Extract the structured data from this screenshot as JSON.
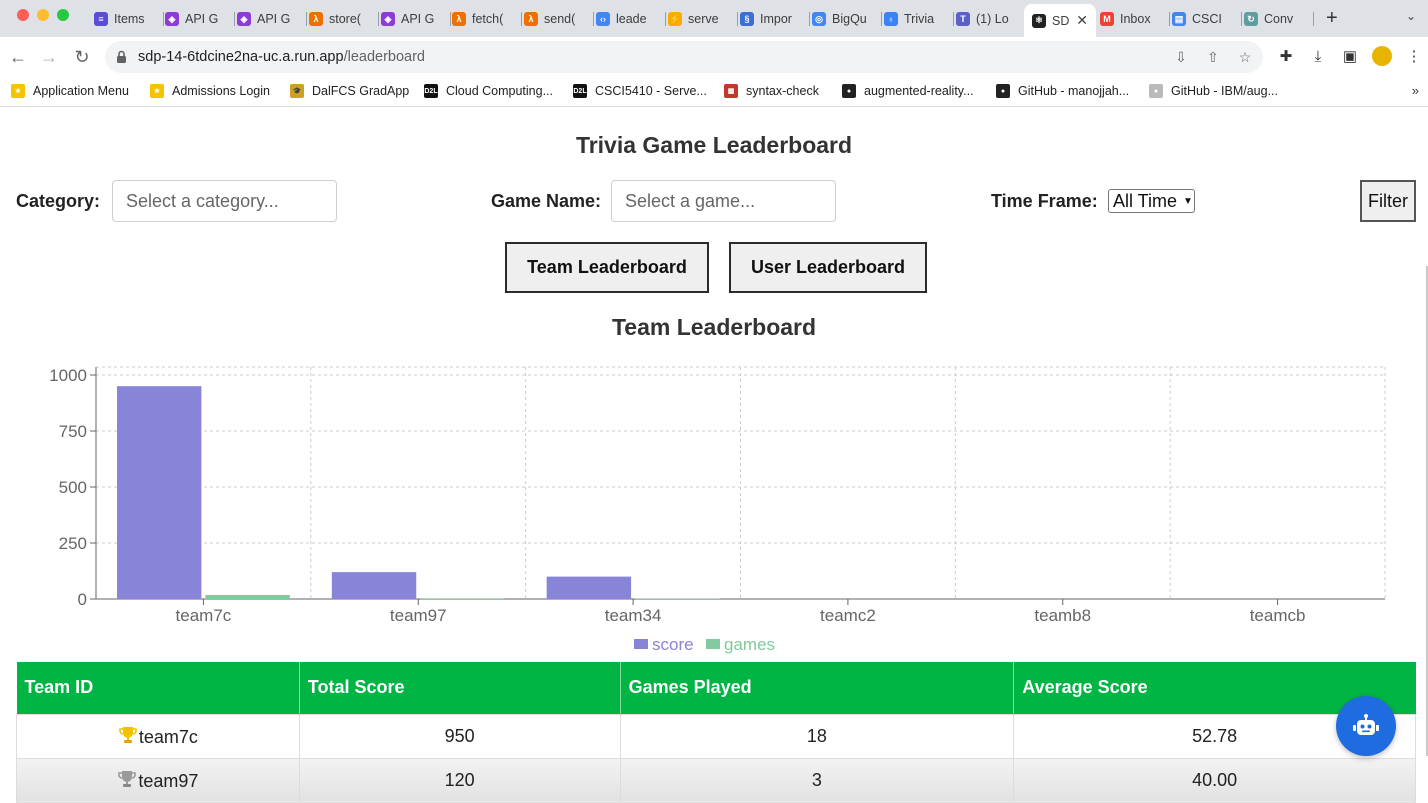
{
  "browser": {
    "tabs": [
      {
        "label": "Items",
        "color": "#5b4bdb",
        "glyph": "≡"
      },
      {
        "label": "API G",
        "color": "#8b3bd6",
        "glyph": "◈"
      },
      {
        "label": "API G",
        "color": "#8b3bd6",
        "glyph": "◈"
      },
      {
        "label": "store(",
        "color": "#ed7100",
        "glyph": "λ"
      },
      {
        "label": "API G",
        "color": "#8b3bd6",
        "glyph": "◈"
      },
      {
        "label": "fetch(",
        "color": "#ed7100",
        "glyph": "λ"
      },
      {
        "label": "send(",
        "color": "#ed7100",
        "glyph": "λ"
      },
      {
        "label": "leade",
        "color": "#4285f4",
        "glyph": "‹›"
      },
      {
        "label": "serve",
        "color": "#f9ab00",
        "glyph": "⚡"
      },
      {
        "label": "Impor",
        "color": "#3b6fd6",
        "glyph": "§"
      },
      {
        "label": "BigQu",
        "color": "#4285f4",
        "glyph": "◎"
      },
      {
        "label": "Trivia",
        "color": "#3b82f6",
        "glyph": "♁"
      },
      {
        "label": "(1) Lo",
        "color": "#5b5fc7",
        "glyph": "T"
      },
      {
        "label": "SD",
        "color": "#222222",
        "glyph": "⚛"
      },
      {
        "label": "Inbox",
        "color": "#ea4335",
        "glyph": "M"
      },
      {
        "label": "CSCI",
        "color": "#4285f4",
        "glyph": "▤"
      },
      {
        "label": "Conv",
        "color": "#5f9ea0",
        "glyph": "↻"
      }
    ],
    "url_host": "sdp-14-6tdcine2na-uc.a.run.app",
    "url_path": "/leaderboard",
    "bookmarks": [
      {
        "label": "Application Menu",
        "color": "#f5c400",
        "glyph": "★"
      },
      {
        "label": "Admissions Login",
        "color": "#f5c400",
        "glyph": "★"
      },
      {
        "label": "DalFCS GradApp",
        "color": "#c9a227",
        "glyph": "🎓"
      },
      {
        "label": "Cloud Computing...",
        "color": "#111111",
        "glyph": "D2L"
      },
      {
        "label": "CSCI5410 - Serve...",
        "color": "#111111",
        "glyph": "D2L"
      },
      {
        "label": "syntax-check",
        "color": "#c0392b",
        "glyph": "▦"
      },
      {
        "label": "augmented-reality...",
        "color": "#222222",
        "glyph": "●"
      },
      {
        "label": "GitHub - manojjah...",
        "color": "#222222",
        "glyph": "●"
      },
      {
        "label": "GitHub - IBM/aug...",
        "color": "#bbbbbb",
        "glyph": "●"
      }
    ]
  },
  "page": {
    "title": "Trivia Game Leaderboard",
    "filters": {
      "category_label": "Category:",
      "category_placeholder": "Select a category...",
      "game_label": "Game Name:",
      "game_placeholder": "Select a game...",
      "timeframe_label": "Time Frame:",
      "timeframe_value": "All Time",
      "filter_button": "Filter"
    },
    "toggle": {
      "team_button": "Team Leaderboard",
      "user_button": "User Leaderboard"
    },
    "section_title": "Team Leaderboard",
    "table": {
      "headers": [
        "Team ID",
        "Total Score",
        "Games Played",
        "Average Score"
      ],
      "rows": [
        {
          "rank_icon": "gold-trophy",
          "team": "team7c",
          "score": "950",
          "games": "18",
          "avg": "52.78"
        },
        {
          "rank_icon": "silver-trophy",
          "team": "team97",
          "score": "120",
          "games": "3",
          "avg": "40.00"
        }
      ]
    }
  },
  "chart_data": {
    "type": "bar",
    "categories": [
      "team7c",
      "team97",
      "team34",
      "teamc2",
      "teamb8",
      "teamcb"
    ],
    "series": [
      {
        "name": "score",
        "color": "#8884d8",
        "values": [
          950,
          120,
          100,
          0,
          0,
          0
        ]
      },
      {
        "name": "games",
        "color": "#82ca9d",
        "values": [
          18,
          3,
          2,
          0,
          0,
          0
        ]
      }
    ],
    "yticks": [
      "0",
      "250",
      "500",
      "750",
      "1000"
    ],
    "ylim": [
      0,
      1000
    ],
    "grid": true,
    "legend": "bottom-center"
  }
}
